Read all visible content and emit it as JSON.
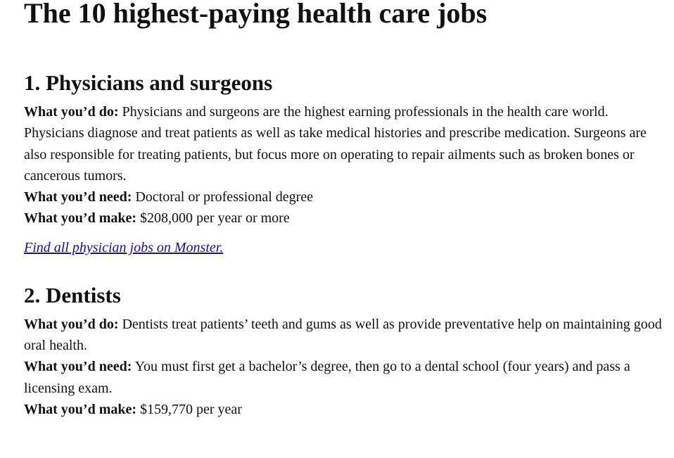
{
  "title": "The 10 highest-paying health care jobs",
  "sections": [
    {
      "heading": "1. Physicians and surgeons",
      "do_label": "What you’d do:",
      "do_text": " Physicians and surgeons are the highest earning professionals in the health care world. Physicians diagnose and treat patients as well as take medical histories and prescribe medication. Surgeons are also responsible for treating patients, but focus more on operating to repair ailments such as broken bones or cancerous tumors.",
      "need_label": "What you’d need:",
      "need_text": " Doctoral or professional degree",
      "make_label": "What you’d make:",
      "make_text": " $208,000 per year or more",
      "link_text": "Find all physician jobs on Monster."
    },
    {
      "heading": "2. Dentists",
      "do_label": "What you’d do:",
      "do_text": " Dentists treat patients’ teeth and gums as well as provide preventative help on maintaining good oral health.",
      "need_label": "What you’d need:",
      "need_text": " You must first get a bachelor’s degree, then go to a dental school (four years) and pass a licensing exam.",
      "make_label": "What you’d make:",
      "make_text": " $159,770 per year"
    }
  ]
}
